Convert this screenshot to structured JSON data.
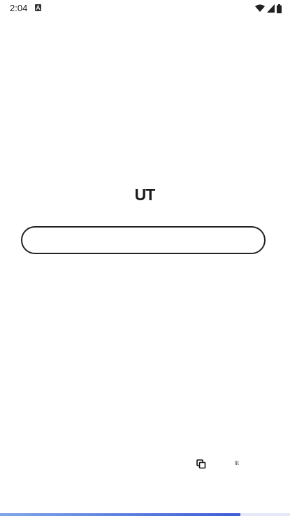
{
  "status_bar": {
    "time": "2:04",
    "notification_icon": "a-box-icon",
    "icons": [
      "wifi-icon",
      "cell-signal-icon",
      "battery-icon"
    ]
  },
  "logo": {
    "text": "UT"
  },
  "input": {
    "value": "",
    "placeholder": ""
  },
  "bottom": {
    "copy_icon": "copy-icon",
    "small_label": "lit"
  },
  "progress": {
    "fraction": 0.83,
    "color_start": "#7fa6e6",
    "color_end": "#3f5bd8"
  }
}
